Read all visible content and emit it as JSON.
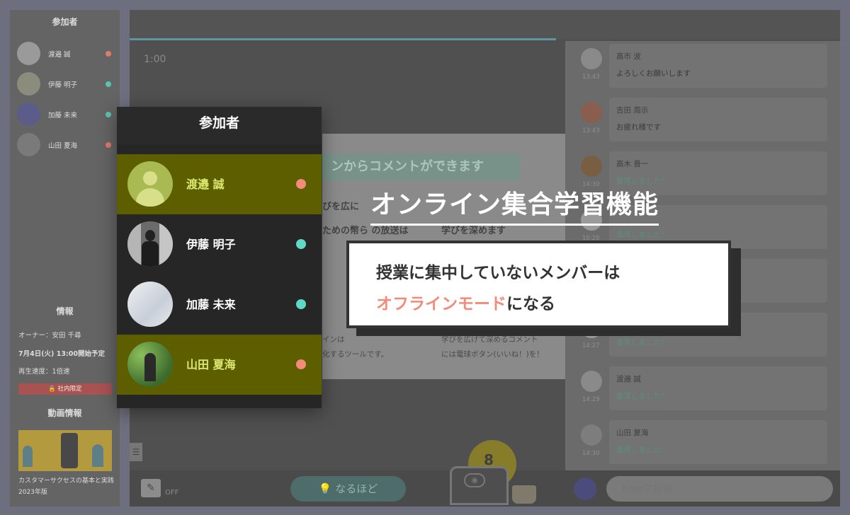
{
  "sidebar": {
    "title": "参加者",
    "participants": [
      {
        "name": "渡邉 誠",
        "status_color": "#e07a6a"
      },
      {
        "name": "伊藤 明子",
        "status_color": "#5bc4b0"
      },
      {
        "name": "加藤 未来",
        "status_color": "#5bc4b0"
      },
      {
        "name": "山田 夏海",
        "status_color": "#e07a6a"
      }
    ],
    "info_title": "情報",
    "owner": "オーナー：安田 千尋",
    "schedule": "7月4日(火) 13:00開始予定",
    "speed": "再生速度：1倍速",
    "restricted_label": "🔒 社内限定",
    "video_info_title": "動画情報",
    "video_title": "カスタマーサクセスの基本と実践　2023年版"
  },
  "player": {
    "time": "1:00",
    "slide_banner": "ンからコメントができます",
    "slide_text_left1": "びを広に",
    "slide_text_left2": "ための幣ら の放送は",
    "slide_text_right": "学びを深めます",
    "slide_small_left1": "インは",
    "slide_small_left2": "化するツールです。",
    "slide_small_right1": "学びを広げて深めるコメント",
    "slide_small_right2": "には電球ボタン(いいね！)を！",
    "off_label": "OFF",
    "naruhodo_label": "💡 なるほど",
    "lamp_text": "8",
    "edit_icon_glyph": "✎",
    "menu_icon_glyph": "☰",
    "laptop_icon_glyph": "◉"
  },
  "chat": {
    "messages": [
      {
        "name": "高市 波",
        "time": "13:43",
        "text": "よろしくお願いします",
        "green": false
      },
      {
        "name": "吉田 周示",
        "time": "13:43",
        "text": "お疲れ様です",
        "green": false
      },
      {
        "name": "高木 晋一",
        "time": "14:30",
        "text": "着席しました！",
        "green": true
      },
      {
        "name": "",
        "time": "10:28",
        "text": "着席しました！",
        "green": true
      },
      {
        "name": "",
        "time": "",
        "text": "",
        "green": false
      },
      {
        "name": "",
        "time": "14:27",
        "text": "着席しました！",
        "green": true
      },
      {
        "name": "渡邉 誠",
        "time": "14:29",
        "text": "着席しました！",
        "green": true
      },
      {
        "name": "山田 夏海",
        "time": "14:30",
        "text": "着席しました！",
        "green": true
      }
    ],
    "input_placeholder": "Enterで投稿"
  },
  "popup": {
    "title": "参加者",
    "participants": [
      {
        "name": "渡邉 誠",
        "status_color": "#f38a7a",
        "highlight": true,
        "avatar": "default-avatar-icon"
      },
      {
        "name": "伊藤 明子",
        "status_color": "#5fd9c6",
        "highlight": false,
        "avatar": "photo"
      },
      {
        "name": "加藤 未来",
        "status_color": "#5fd9c6",
        "highlight": false,
        "avatar": "photo"
      },
      {
        "name": "山田 夏海",
        "status_color": "#f38a7a",
        "highlight": true,
        "avatar": "photo"
      }
    ]
  },
  "overlay": {
    "headline": "オンライン集合学習機能",
    "callout_line1": "授業に集中していないメンバーは",
    "callout_accent": "オフラインモード",
    "callout_rest": "になる",
    "accent_color": "#f38a7a"
  }
}
